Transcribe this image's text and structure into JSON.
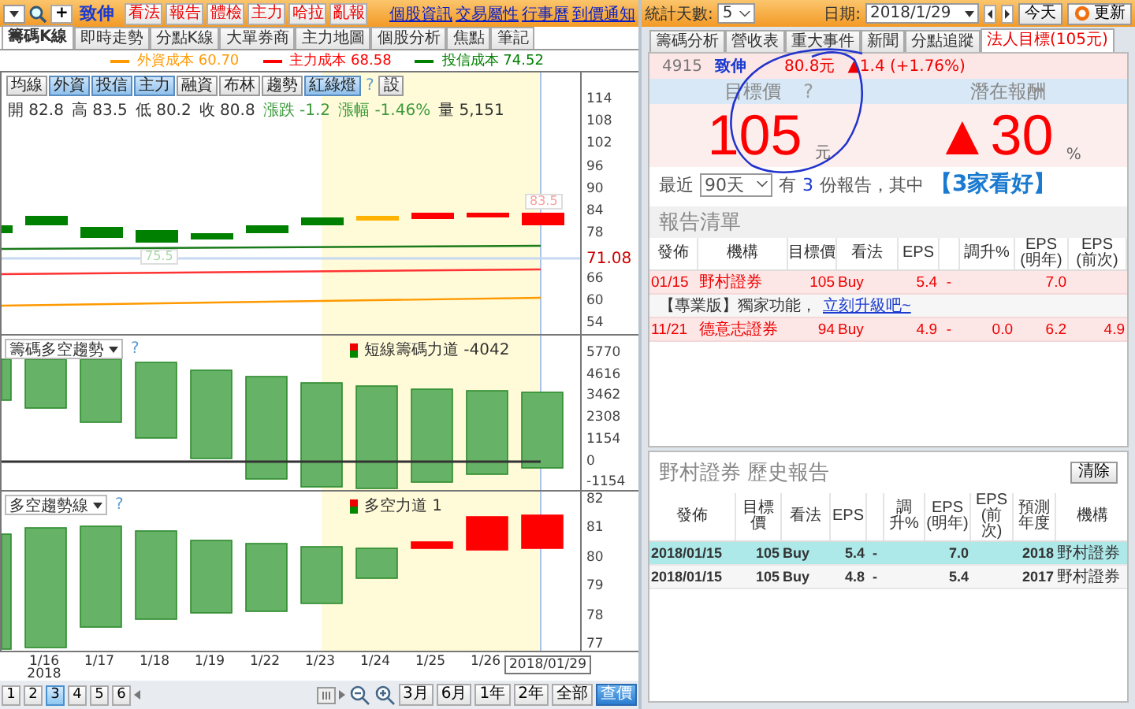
{
  "toolbar": {
    "add_button": "+",
    "stock_name": "致伸",
    "action_buttons": [
      "看法",
      "報告",
      "體檢",
      "主力",
      "哈拉",
      "亂報"
    ],
    "links": [
      "個股資訊",
      "交易屬性",
      "行事曆",
      "到價通知"
    ]
  },
  "chart_tabs": [
    {
      "label": "籌碼K線",
      "selected": true
    },
    {
      "label": "即時走勢",
      "selected": false
    },
    {
      "label": "分點K線",
      "selected": false
    },
    {
      "label": "大單券商",
      "selected": false
    },
    {
      "label": "主力地圖",
      "selected": false
    },
    {
      "label": "個股分析",
      "selected": false
    },
    {
      "label": "焦點",
      "selected": false
    },
    {
      "label": "筆記",
      "selected": false
    }
  ],
  "cost_legend": [
    {
      "label": "外資成本 60.70",
      "color": "#ff9900"
    },
    {
      "label": "主力成本 68.58",
      "color": "#ff0000"
    },
    {
      "label": "投信成本 74.52",
      "color": "#008000"
    }
  ],
  "main_pane": {
    "indicator_buttons": [
      {
        "label": "均線",
        "on": false
      },
      {
        "label": "外資",
        "on": true
      },
      {
        "label": "投信",
        "on": true
      },
      {
        "label": "主力",
        "on": true
      },
      {
        "label": "融資",
        "on": false
      },
      {
        "label": "布林",
        "on": false
      },
      {
        "label": "趨勢",
        "on": false
      },
      {
        "label": "紅綠燈",
        "on": true
      }
    ],
    "help": "?",
    "settings_button": "設",
    "quote": {
      "open": "開 82.8",
      "high": "高 83.5",
      "low": "低 80.2",
      "close": "收 80.8",
      "change": "漲跌 -1.2",
      "change_pct": "漲幅 -1.46%",
      "volume": "量 5,151"
    },
    "ticks": [
      "114",
      "108",
      "102",
      "96",
      "90",
      "84",
      "78",
      "66",
      "60",
      "54"
    ],
    "cursor_price": "71.08",
    "high_tag": "83.5",
    "low_tag": "75.5"
  },
  "chip_pane": {
    "selector": "籌碼多空趨勢",
    "help": "?",
    "legend": "短線籌碼力道 -4042",
    "ticks": [
      "5770",
      "4616",
      "3462",
      "2308",
      "1154",
      "0",
      "-1154"
    ]
  },
  "trend_pane": {
    "selector": "多空趨勢線",
    "help": "?",
    "legend": "多空力道 1",
    "ticks": [
      "82",
      "81",
      "80",
      "79",
      "78",
      "77"
    ]
  },
  "x_axis": {
    "labels": [
      "1/16",
      "1/17",
      "1/18",
      "1/19",
      "1/22",
      "1/23",
      "1/24",
      "1/25",
      "1/26"
    ],
    "year": "2018",
    "cursor_date": "2018/01/29"
  },
  "bottom_bar": {
    "pages": [
      {
        "label": "1",
        "selected": false
      },
      {
        "label": "2",
        "selected": false
      },
      {
        "label": "3",
        "selected": true
      },
      {
        "label": "4",
        "selected": false
      },
      {
        "label": "5",
        "selected": false
      },
      {
        "label": "6",
        "selected": false
      }
    ],
    "ranges": [
      {
        "label": "3月",
        "selected": false
      },
      {
        "label": "6月",
        "selected": false
      },
      {
        "label": "1年",
        "selected": false
      },
      {
        "label": "2年",
        "selected": false
      },
      {
        "label": "全部",
        "selected": false
      },
      {
        "label": "查價",
        "selected": true
      }
    ]
  },
  "right_toolbar": {
    "days_label": "統計天數:",
    "days_value": "5",
    "date_label": "日期:",
    "date_value": "2018/1/29",
    "today_button": "今天",
    "refresh_button": "更新"
  },
  "right_tabs": [
    {
      "label": "籌碼分析",
      "selected": false
    },
    {
      "label": "營收表",
      "selected": false
    },
    {
      "label": "重大事件",
      "selected": false
    },
    {
      "label": "新聞",
      "selected": false
    },
    {
      "label": "分點追蹤",
      "selected": false
    },
    {
      "label": "法人目標(105元)",
      "selected": true
    }
  ],
  "stock": {
    "code": "4915",
    "name": "致伸",
    "price": "80.8元",
    "change": "▲1.4 (+1.76%)"
  },
  "target": {
    "heading": "目標價",
    "help": "?",
    "value": "105",
    "unit": "元"
  },
  "potential": {
    "heading": "潛在報酬",
    "value": "▲30",
    "unit": "%"
  },
  "summary": {
    "prefix": "最近",
    "period": "90天",
    "has": "有",
    "count": "3",
    "text": "份報告，其中",
    "highlight": "【3家看好】"
  },
  "report_list": {
    "title": "報告清單",
    "columns": [
      "發佈",
      "機構",
      "目標價",
      "看法",
      "EPS",
      null,
      "調升%",
      "EPS\n(明年)",
      "EPS\n(前次)"
    ],
    "rows": [
      {
        "kind": "report",
        "cells": [
          "01/15",
          "野村證券",
          "105",
          "Buy",
          "5.4",
          "-",
          null,
          "7.0",
          null
        ]
      },
      {
        "kind": "promo",
        "text": "【專業版】獨家功能，",
        "link": "立刻升級吧~"
      },
      {
        "kind": "report",
        "cells": [
          "11/21",
          "德意志證券",
          "94",
          "Buy",
          "4.9",
          "-",
          "0.0",
          "6.2",
          "4.9"
        ]
      }
    ]
  },
  "history": {
    "title": "野村證券 歷史報告",
    "clear_button": "清除",
    "columns": [
      "發佈",
      "目標價",
      "看法",
      "EPS",
      null,
      "調升%",
      "EPS\n(明年)",
      "EPS\n(前次)",
      "預測年度",
      "機構"
    ],
    "rows": [
      {
        "selected": true,
        "cells": [
          "2018/01/15",
          "105",
          "Buy",
          "5.4",
          "-",
          null,
          "7.0",
          null,
          "2018",
          "野村證券"
        ]
      },
      {
        "selected": false,
        "cells": [
          "2018/01/15",
          "105",
          "Buy",
          "4.8",
          "-",
          null,
          "5.4",
          null,
          "2017",
          "野村證券"
        ]
      }
    ]
  }
}
